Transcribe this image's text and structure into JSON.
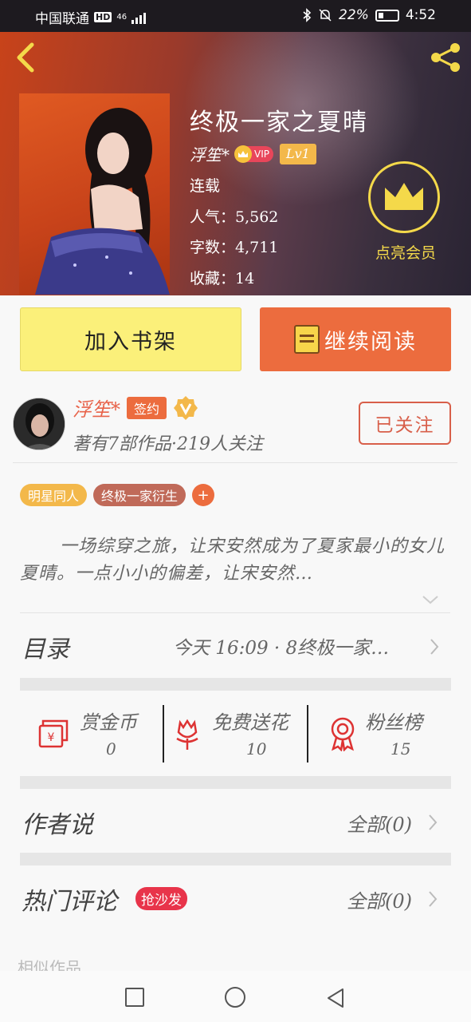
{
  "status_bar": {
    "carrier": "中国联通",
    "hd": "HD",
    "network": "46",
    "battery_percent": "22%",
    "time": "4:52"
  },
  "header": {
    "back_icon": "chevron-left-icon",
    "share_icon": "share-icon"
  },
  "book": {
    "title": "终极一家之夏晴",
    "author": "浮笙*",
    "vip_badge": "VIP",
    "level_badge": "Lv1",
    "status": "连载",
    "popularity": "人气：5,562",
    "word_count": "字数：4,711",
    "favorites": "收藏：14",
    "member_label": "点亮会员"
  },
  "actions": {
    "add_to_shelf": "加入书架",
    "continue_reading": "继续阅读"
  },
  "author_card": {
    "name": "浮笙*",
    "signed_badge": "签约",
    "stats": "著有7部作品·219人关注",
    "follow_button": "已关注"
  },
  "tags": [
    "明星同人",
    "终极一家衍生"
  ],
  "tag_add": "+",
  "synopsis": "一场综穿之旅，让宋安然成为了夏家最小的女儿夏晴。一点小小的偏差，让宋安然…",
  "catalog": {
    "title": "目录",
    "latest": "今天 16:09 · 8终极一家…"
  },
  "stats": [
    {
      "label": "赏金币",
      "value": "0",
      "icon": "red-envelope-icon"
    },
    {
      "label": "免费送花",
      "value": "10",
      "icon": "flower-icon"
    },
    {
      "label": "粉丝榜",
      "value": "15",
      "icon": "medal-icon"
    }
  ],
  "author_says": {
    "title": "作者说",
    "all": "全部(0)"
  },
  "hot_comments": {
    "title": "热门评论",
    "sofa_badge": "抢沙发",
    "all": "全部(0)"
  },
  "similar_works": "相似作品",
  "colors": {
    "accent_orange": "#ec6c3e",
    "shelf_yellow": "#fbf07a",
    "crown_yellow": "#f4d94a",
    "sofa_red": "#e8344a"
  }
}
